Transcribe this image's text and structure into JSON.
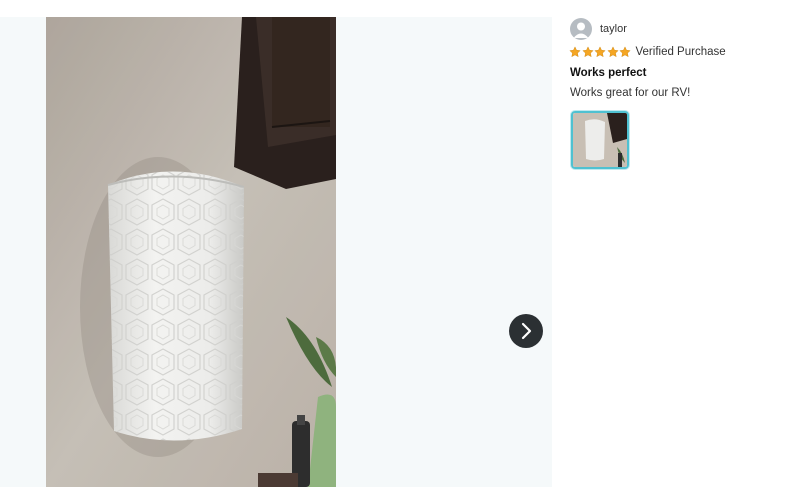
{
  "review": {
    "reviewer_name": "taylor",
    "rating": 5,
    "rating_max": 5,
    "verified_label": "Verified Purchase",
    "title": "Works perfect",
    "body": "Works great for our RV!"
  },
  "colors": {
    "star": "#f5a623",
    "thumbnail_border": "#4fc1d1",
    "next_button_bg": "#2b3033"
  },
  "icons": {
    "next": "chevron-right-icon",
    "avatar": "user-silhouette-icon",
    "star": "star-icon"
  }
}
